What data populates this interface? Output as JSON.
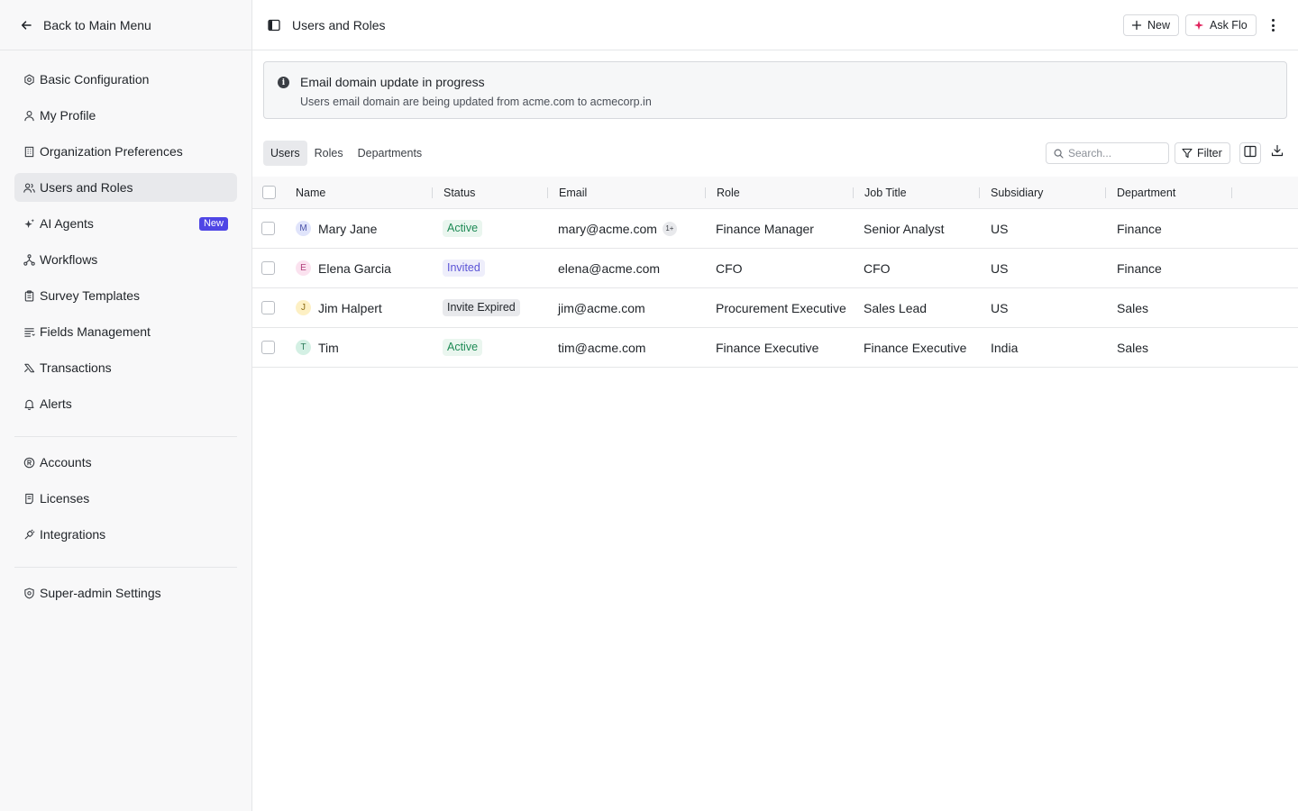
{
  "sidebar": {
    "back_label": "Back to Main Menu",
    "groups": [
      [
        {
          "label": "Basic Configuration",
          "icon": "gear-icon"
        },
        {
          "label": "My Profile",
          "icon": "user-icon"
        },
        {
          "label": "Organization Preferences",
          "icon": "building-icon"
        },
        {
          "label": "Users and Roles",
          "icon": "users-icon",
          "active": true
        },
        {
          "label": "AI Agents",
          "icon": "sparkle-icon",
          "badge": "New"
        },
        {
          "label": "Workflows",
          "icon": "workflow-icon"
        },
        {
          "label": "Survey Templates",
          "icon": "clipboard-icon"
        },
        {
          "label": "Fields Management",
          "icon": "list-icon"
        },
        {
          "label": "Transactions",
          "icon": "transactions-icon"
        },
        {
          "label": "Alerts",
          "icon": "bell-icon"
        }
      ],
      [
        {
          "label": "Accounts",
          "icon": "registered-icon"
        },
        {
          "label": "Licenses",
          "icon": "license-icon"
        },
        {
          "label": "Integrations",
          "icon": "plug-icon"
        }
      ],
      [
        {
          "label": "Super-admin Settings",
          "icon": "shield-icon"
        }
      ]
    ]
  },
  "header": {
    "title": "Users and Roles",
    "new_label": "New",
    "ask_label": "Ask Flo"
  },
  "banner": {
    "title": "Email domain update in progress",
    "body": "Users email domain are being updated from acme.com to acmecorp.in"
  },
  "tabs": [
    "Users",
    "Roles",
    "Departments"
  ],
  "toolbar": {
    "search_placeholder": "Search...",
    "filter_label": "Filter"
  },
  "table": {
    "columns": [
      "Name",
      "Status",
      "Email",
      "Role",
      "Job Title",
      "Subsidiary",
      "Department"
    ],
    "rows": [
      {
        "initial": "M",
        "name": "Mary Jane",
        "status": "Active",
        "email": "mary@acme.com",
        "email_extra": "1+",
        "role": "Finance Manager",
        "job_title": "Senior Analyst",
        "subsidiary": "US",
        "department": "Finance"
      },
      {
        "initial": "E",
        "name": "Elena Garcia",
        "status": "Invited",
        "email": "elena@acme.com",
        "role": "CFO",
        "job_title": "CFO",
        "subsidiary": "US",
        "department": "Finance"
      },
      {
        "initial": "J",
        "name": "Jim Halpert",
        "status": "Invite Expired",
        "email": "jim@acme.com",
        "role": "Procurement Executive",
        "job_title": "Sales Lead",
        "subsidiary": "US",
        "department": "Sales"
      },
      {
        "initial": "T",
        "name": "Tim",
        "status": "Active",
        "email": "tim@acme.com",
        "role": "Finance Executive",
        "job_title": "Finance Executive",
        "subsidiary": "India",
        "department": "Sales"
      }
    ]
  },
  "colors": {
    "accent": "#4f46e5",
    "active_status": "#1e8a55",
    "invited_status": "#5b54d6",
    "ask_flo_icon": "#e0245e"
  }
}
